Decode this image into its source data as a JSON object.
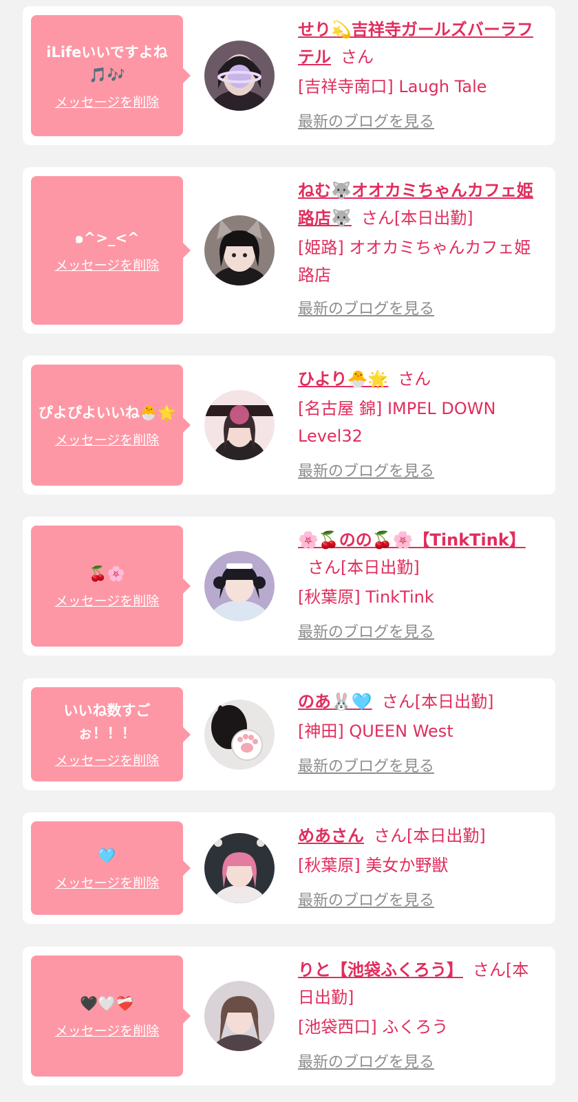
{
  "delete_label": "メッセージを削除",
  "blog_label": "最新のブログを見る",
  "colors": {
    "bubble": "#fe97a5",
    "accent": "#e02d5d",
    "link_gray": "#8d8d8d",
    "background": "#f2f2f2"
  },
  "items": [
    {
      "message": "iLifeいいですよね🎵🎶",
      "name": "せり💫吉祥寺ガールズバーラフテル",
      "suffix": "さん",
      "shop": "[吉祥寺南口] Laugh Tale",
      "avatar_icon": "portrait-with-planet-sticker-icon"
    },
    {
      "message": "๑^>_<^",
      "name": "ねむ🐺オオカミちゃんカフェ姫路店🐺",
      "suffix": "さん[本日出勤]",
      "shop": "[姫路] オオカミちゃんカフェ姫路店",
      "avatar_icon": "portrait-with-wolf-ears-icon"
    },
    {
      "message": "ぴよぴよいいね🐣🌟",
      "name": "ひより🐣🌟",
      "suffix": "さん",
      "shop": "[名古屋 錦] IMPEL DOWN Level32",
      "avatar_icon": "portrait-with-cafe-sign-icon"
    },
    {
      "message": "🍒🌸",
      "name": "🌸🍒のの🍒🌸【TinkTink】",
      "suffix": "さん[本日出勤]",
      "shop": "[秋葉原] TinkTink",
      "avatar_icon": "portrait-maid-icon"
    },
    {
      "message": "いいね数すごぉ！！！",
      "name": "のあ🐰🩵",
      "suffix": "さん[本日出勤]",
      "shop": "[神田] QUEEN West",
      "avatar_icon": "portrait-cat-paw-icon"
    },
    {
      "message": "🩵",
      "name": "めあさん",
      "suffix": "さん[本日出勤]",
      "shop": "[秋葉原] 美女か野獣",
      "avatar_icon": "portrait-pink-hair-icon"
    },
    {
      "message": "🖤🤍❤️‍🩹",
      "name": "りと【池袋ふくろう】",
      "suffix": "さん[本日出勤]",
      "shop": "[池袋西口] ふくろう",
      "avatar_icon": "portrait-brown-hair-icon"
    }
  ]
}
